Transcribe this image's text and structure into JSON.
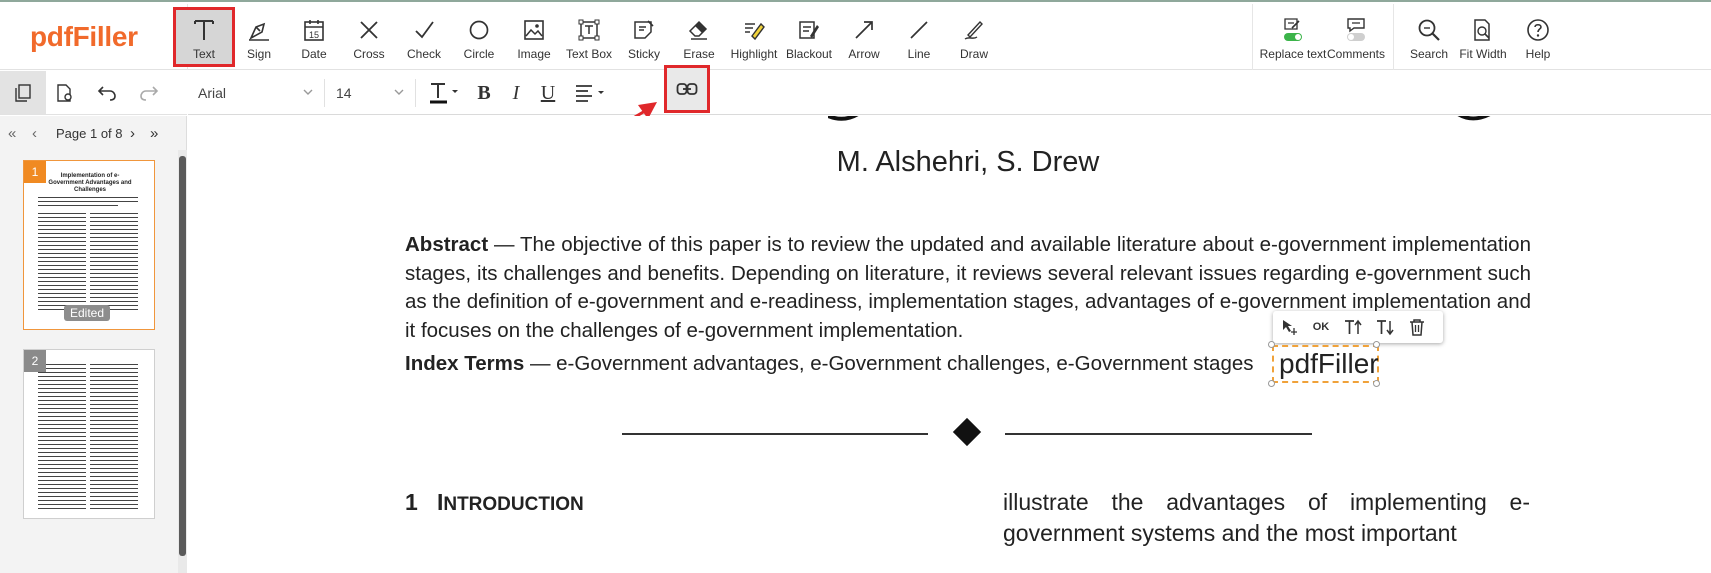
{
  "app": {
    "logo": "pdfFiller"
  },
  "toolbar": {
    "tools": [
      {
        "label": "Text",
        "icon": "text-icon"
      },
      {
        "label": "Sign",
        "icon": "pen-nib-icon"
      },
      {
        "label": "Date",
        "icon": "calendar-icon"
      },
      {
        "label": "Cross",
        "icon": "cross-icon"
      },
      {
        "label": "Check",
        "icon": "check-icon"
      },
      {
        "label": "Circle",
        "icon": "circle-icon"
      },
      {
        "label": "Image",
        "icon": "image-icon"
      },
      {
        "label": "Text Box",
        "icon": "text-box-icon"
      },
      {
        "label": "Sticky",
        "icon": "sticky-note-icon"
      },
      {
        "label": "Erase",
        "icon": "eraser-icon"
      },
      {
        "label": "Highlight",
        "icon": "highlighter-icon"
      },
      {
        "label": "Blackout",
        "icon": "blackout-icon"
      },
      {
        "label": "Arrow",
        "icon": "arrow-icon"
      },
      {
        "label": "Line",
        "icon": "line-icon"
      },
      {
        "label": "Draw",
        "icon": "pencil-icon"
      }
    ],
    "right": [
      {
        "label": "Replace text",
        "icon": "replace-text-toggle-icon"
      },
      {
        "label": "Comments",
        "icon": "comments-toggle-icon"
      },
      {
        "label": "Search",
        "icon": "search-icon"
      },
      {
        "label": "Fit Width",
        "icon": "fit-width-icon"
      },
      {
        "label": "Help",
        "icon": "help-icon"
      }
    ],
    "date_icon_text": "15"
  },
  "format": {
    "font": "Arial",
    "size": "14",
    "bold": "B",
    "italic": "I",
    "underline": "U"
  },
  "sidebar": {
    "page_label": "Page 1 of 8",
    "thumbnails": [
      {
        "num": "1",
        "badge": "Edited",
        "title": "Implementation of e-Government Advantages and Challenges"
      },
      {
        "num": "2"
      }
    ]
  },
  "document": {
    "authors": "M. Alshehri, S. Drew",
    "abstract_label": "Abstract",
    "abstract_text": " — The objective of this paper is to review the updated and available literature about e-government implementation stages, its challenges and benefits. Depending on literature, it reviews several relevant issues regarding e-government such as the definition of e-government and e-readiness, implementation stages, advantages of e-government implementation and it focuses on the challenges of e-government implementation.",
    "index_label": "Index Terms",
    "index_text": " — e-Government advantages, e-Government challenges, e-Government stages",
    "section_num": "1",
    "section_first": "I",
    "section_rest": "NTRODUCTION",
    "col2_text": "illustrate the advantages of implementing e-government systems and the most important"
  },
  "editor": {
    "text": "pdfFiller",
    "ok_label": "OK"
  },
  "colors": {
    "brand": "#f16a2b",
    "highlight_box": "#e0282b",
    "edit_border": "#f0a23a"
  }
}
